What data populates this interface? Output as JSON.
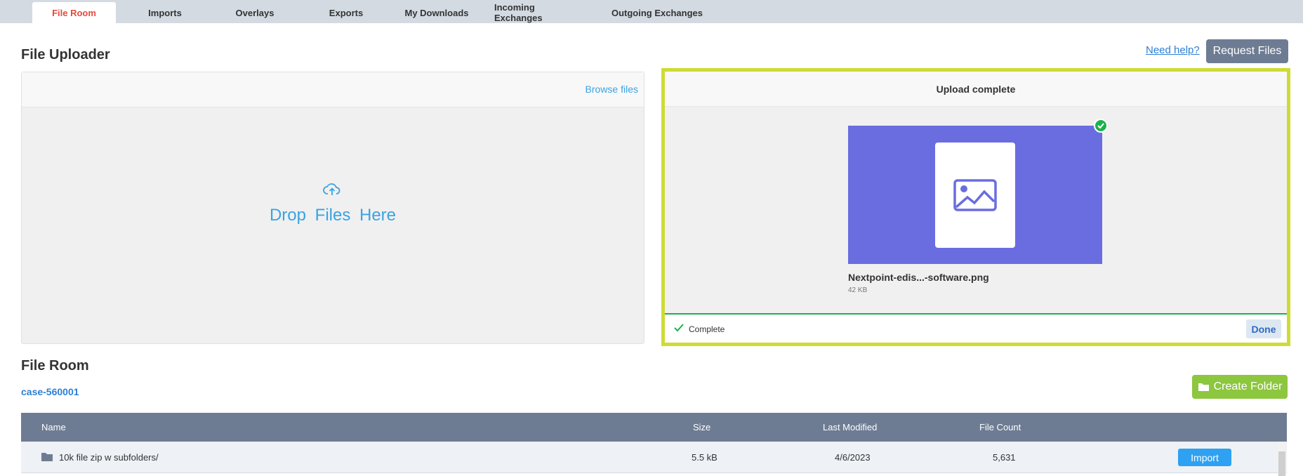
{
  "tabs": [
    {
      "label": "File Room"
    },
    {
      "label": "Imports"
    },
    {
      "label": "Overlays"
    },
    {
      "label": "Exports"
    },
    {
      "label": "My Downloads"
    },
    {
      "label": "Incoming Exchanges"
    },
    {
      "label": "Outgoing Exchanges"
    }
  ],
  "uploader": {
    "title": "File Uploader",
    "need_help": "Need help?",
    "request_files": "Request Files",
    "browse_files": "Browse files",
    "drop_text": "Drop Files Here"
  },
  "upload_panel": {
    "status_title": "Upload complete",
    "file_name": "Nextpoint-edis...-software.png",
    "file_size": "42 KB",
    "complete_label": "Complete",
    "done_label": "Done",
    "thumbnail_color": "#6a6de0",
    "highlight_color": "#cedb35",
    "success_color": "#1bb24b"
  },
  "file_room": {
    "title": "File Room",
    "case": "case-560001",
    "create_folder": "Create Folder",
    "columns": [
      "Name",
      "Size",
      "Last Modified",
      "File Count"
    ],
    "rows": [
      {
        "name": "10k file zip w subfolders/",
        "size": "5.5 kB",
        "modified": "4/6/2023",
        "count": "5,631",
        "action": "Import"
      }
    ]
  }
}
